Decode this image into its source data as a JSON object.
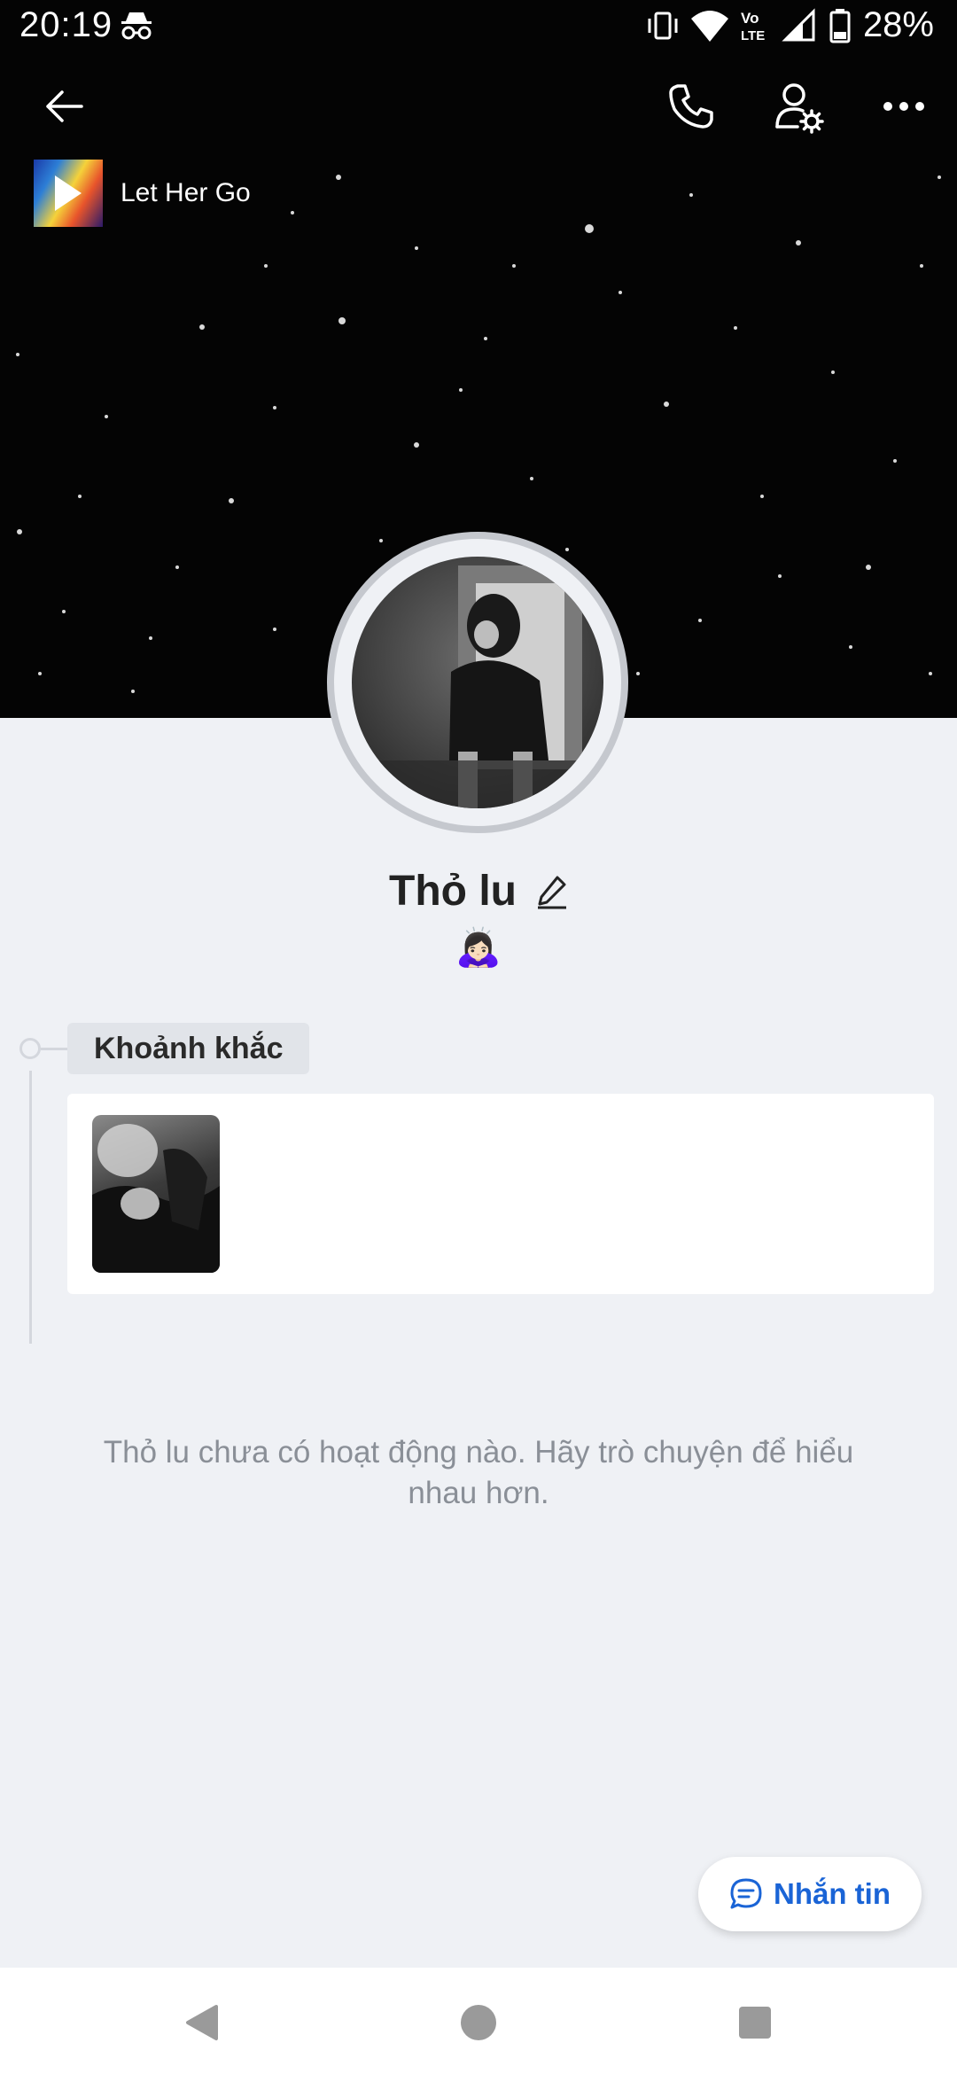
{
  "status_bar": {
    "time": "20:19",
    "battery": "28%",
    "icons": [
      "incognito-icon",
      "vibrate-icon",
      "wifi-icon",
      "volte-icon",
      "signal-icon",
      "battery-icon"
    ]
  },
  "top_bar": {
    "icons": [
      "back-arrow-icon",
      "phone-icon",
      "user-settings-icon",
      "more-icon"
    ]
  },
  "music": {
    "title": "Let Her Go"
  },
  "profile": {
    "name": "Thỏ lu",
    "emoji": "🙇🏻‍♀️"
  },
  "moments": {
    "label": "Khoảnh khắc"
  },
  "empty_state": {
    "text": "Thỏ lu chưa có hoạt động nào. Hãy trò chuyện để hiểu nhau hơn."
  },
  "message_button": {
    "label": "Nhắn tin"
  },
  "colors": {
    "accent": "#1a64d6",
    "background": "#eff1f5",
    "cover": "#040404"
  }
}
